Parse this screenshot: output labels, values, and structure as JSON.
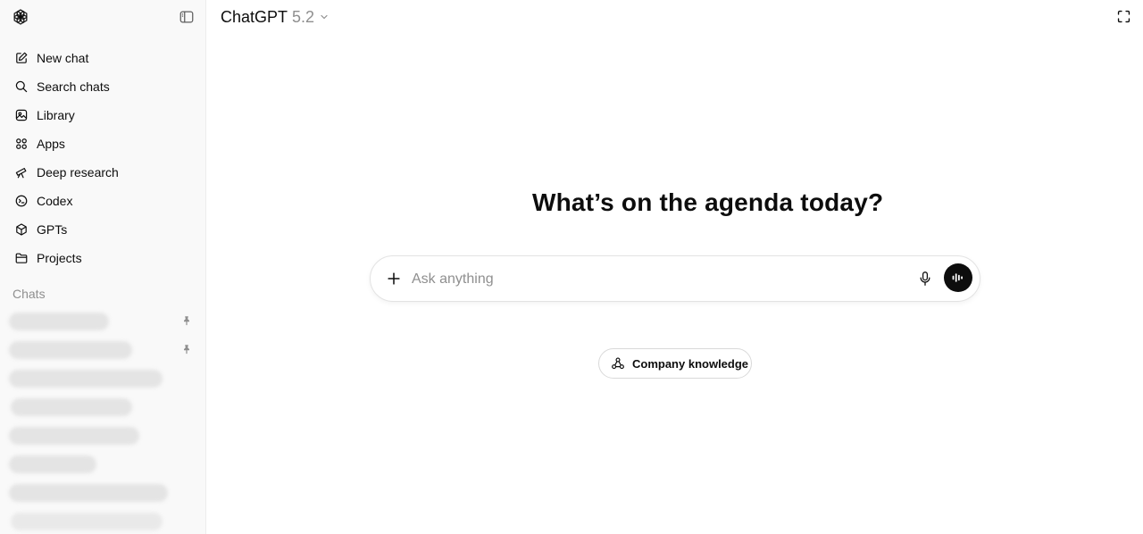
{
  "header": {
    "model_name": "ChatGPT",
    "model_version": "5.2"
  },
  "sidebar": {
    "items": [
      {
        "label": "New chat",
        "icon": "edit-icon"
      },
      {
        "label": "Search chats",
        "icon": "search-icon"
      },
      {
        "label": "Library",
        "icon": "library-icon"
      },
      {
        "label": "Apps",
        "icon": "apps-icon"
      },
      {
        "label": "Deep research",
        "icon": "telescope-icon"
      },
      {
        "label": "Codex",
        "icon": "codex-icon"
      },
      {
        "label": "GPTs",
        "icon": "cube-icon"
      },
      {
        "label": "Projects",
        "icon": "folder-icon"
      }
    ],
    "chats_label": "Chats"
  },
  "main": {
    "headline": "What’s on the agenda today?",
    "composer": {
      "placeholder": "Ask anything"
    },
    "company_knowledge_label": "Company knowledge"
  },
  "colors": {
    "text": "#0d0d0d",
    "muted": "#8f8f8f",
    "sidebar_bg": "#f9f9f9",
    "voice_button": "#0d0d0d"
  }
}
